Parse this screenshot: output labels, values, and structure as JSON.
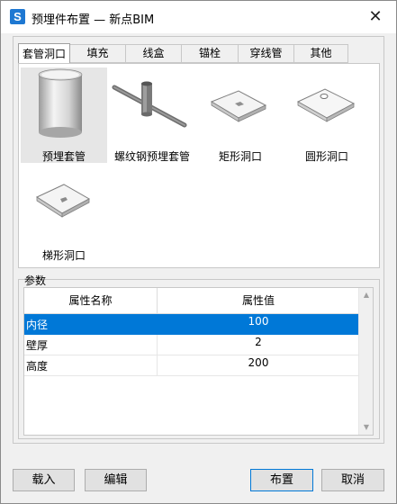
{
  "window": {
    "app_icon_letter": "S",
    "title": "预埋件布置 — 新点BIM",
    "close_symbol": "✕"
  },
  "tabs": [
    {
      "label": "套管洞口",
      "active": true
    },
    {
      "label": "填充"
    },
    {
      "label": "线盒"
    },
    {
      "label": "锚栓"
    },
    {
      "label": "穿线管"
    },
    {
      "label": "其他"
    }
  ],
  "items": [
    {
      "label": "预埋套管",
      "icon": "cylinder-sleeve-icon",
      "selected": true
    },
    {
      "label": "螺纹钢预埋套管",
      "icon": "rebar-sleeve-icon"
    },
    {
      "label": "矩形洞口",
      "icon": "rect-opening-icon"
    },
    {
      "label": "圆形洞口",
      "icon": "round-opening-icon"
    },
    {
      "label": "梯形洞口",
      "icon": "trapezoid-opening-icon"
    }
  ],
  "params": {
    "group_label": "参数",
    "columns": [
      "属性名称",
      "属性值"
    ],
    "rows": [
      {
        "name": "内径",
        "value": "100",
        "selected": true
      },
      {
        "name": "壁厚",
        "value": "2"
      },
      {
        "name": "高度",
        "value": "200"
      }
    ]
  },
  "buttons": {
    "import": "载入",
    "edit": "编辑",
    "place": "布置",
    "cancel": "取消"
  },
  "colors": {
    "selection": "#0078d7",
    "app_icon": "#1e78d2"
  }
}
